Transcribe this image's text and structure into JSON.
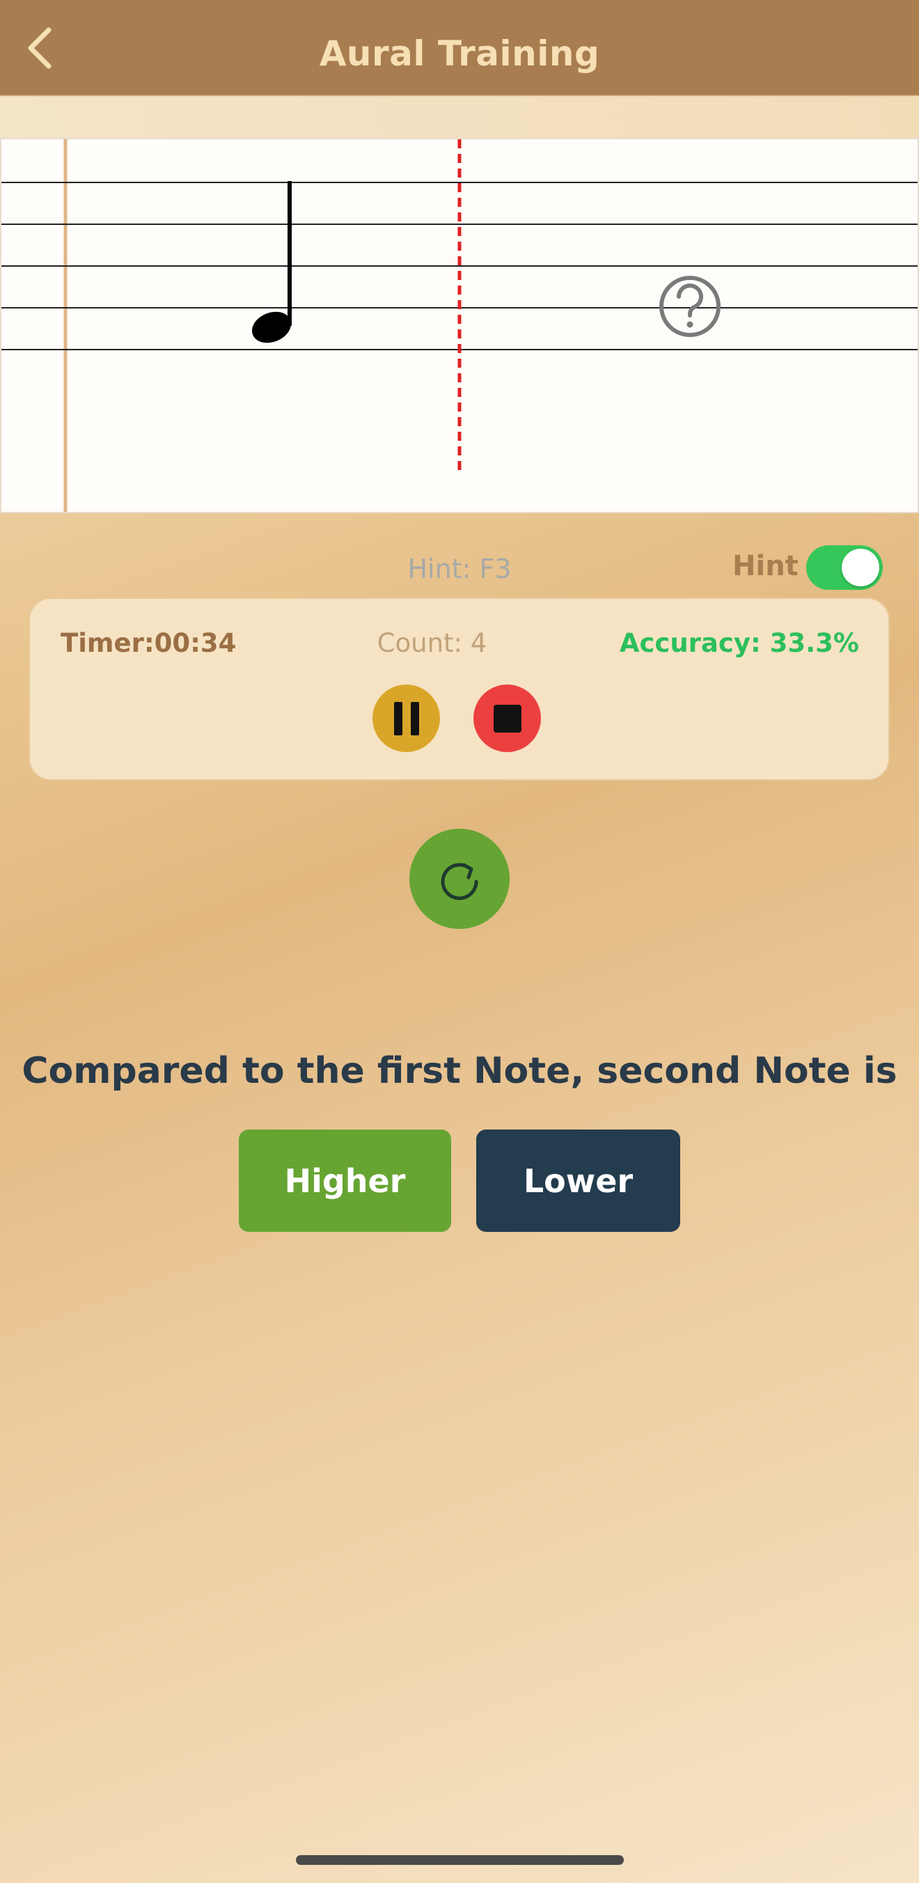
{
  "header": {
    "title": "Aural Training"
  },
  "hint": {
    "text": "Hint: F3",
    "label": "Hint",
    "enabled": true
  },
  "stats": {
    "timer": "Timer:00:34",
    "count": "Count: 4",
    "accuracy": "Accuracy: 33.3%"
  },
  "prompt": {
    "question": "Compared to the first Note, second Note is"
  },
  "answers": {
    "higher": "Higher",
    "lower": "Lower"
  },
  "colors": {
    "header_bg": "#a87d4f",
    "title": "#f7dfb5",
    "pause": "#daa62a",
    "stop": "#ec4040",
    "replay": "#66a534",
    "higher": "#67a533",
    "lower": "#233c4e",
    "accuracy": "#2cbf5c",
    "toggle_on": "#35c759"
  },
  "icons": {
    "back": "chevron-left-icon",
    "note": "quarter-note-icon",
    "unknown": "question-mark-icon",
    "pause": "pause-icon",
    "stop": "stop-icon",
    "replay": "refresh-icon"
  }
}
